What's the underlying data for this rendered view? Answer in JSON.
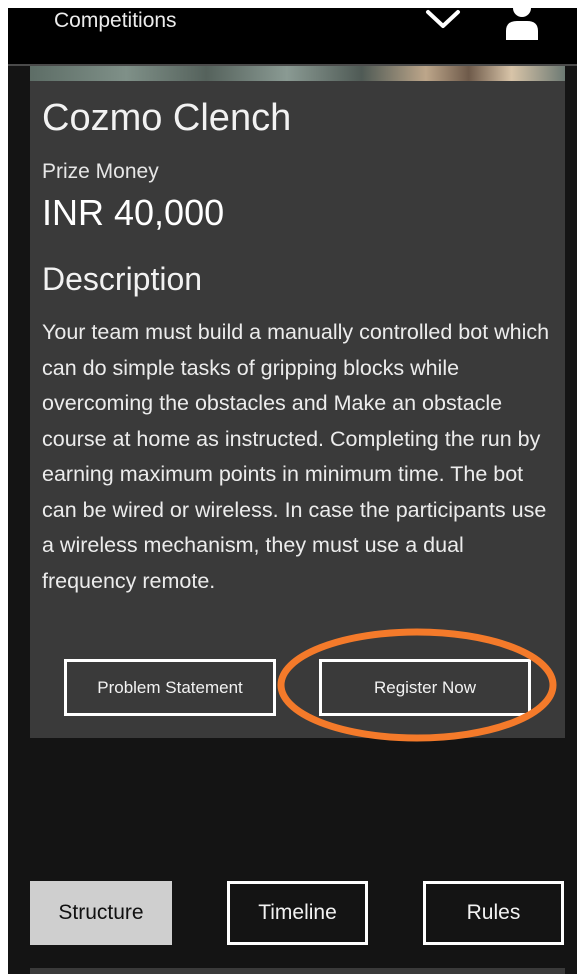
{
  "header": {
    "title": "Competitions",
    "icons": [
      "chevron-down-icon",
      "user-icon"
    ]
  },
  "competition": {
    "name": "Cozmo Clench",
    "prize_label": "Prize Money",
    "prize_value": "INR 40,000",
    "description_heading": "Description",
    "description": "Your team must build a manually controlled bot which can do simple tasks of gripping blocks while overcoming the obstacles and Make an obstacle course at home as instructed. Completing the run by earning maximum points in minimum time. The bot can be wired or wireless. In case the participants use a wireless mechanism, they must use a dual frequency remote."
  },
  "actions": {
    "problem_statement": "Problem Statement",
    "register_now": "Register Now"
  },
  "tabs": [
    {
      "label": "Structure",
      "selected": true
    },
    {
      "label": "Timeline",
      "selected": false
    },
    {
      "label": "Rules",
      "selected": false
    }
  ],
  "colors": {
    "background": "#141414",
    "card": "#3a3a3a",
    "topbar": "#000000",
    "highlight": "#f47a2a",
    "selected_tab": "#cfcfcf"
  }
}
